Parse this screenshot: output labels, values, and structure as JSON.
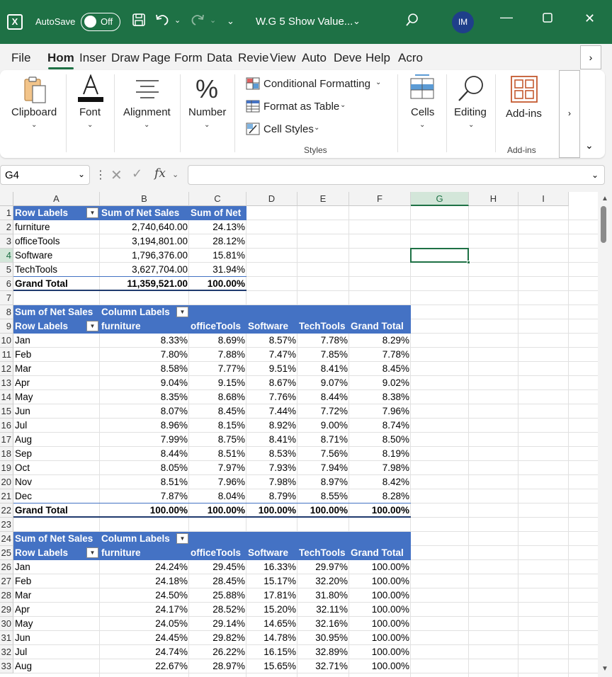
{
  "titlebar": {
    "autosave_label": "AutoSave",
    "autosave_state": "Off",
    "doc_title": "W.G 5 Show Value...",
    "avatar_initials": "IM",
    "accent_color": "#1e7145"
  },
  "tabs": [
    "File",
    "Hom",
    "Inser",
    "Draw",
    "Page",
    "Form",
    "Data",
    "Revie",
    "View",
    "Auto",
    "Deve",
    "Help",
    "Acro"
  ],
  "ribbon": {
    "clipboard": "Clipboard",
    "font": "Font",
    "alignment": "Alignment",
    "number": "Number",
    "conditional_formatting": "Conditional Formatting",
    "format_as_table": "Format as Table",
    "cell_styles": "Cell Styles",
    "styles_group": "Styles",
    "cells": "Cells",
    "editing": "Editing",
    "addins": "Add-ins",
    "addins_group": "Add-ins"
  },
  "formula_bar": {
    "name_box": "G4",
    "fx": "fx",
    "formula": ""
  },
  "columns": [
    "A",
    "B",
    "C",
    "D",
    "E",
    "F",
    "G",
    "H",
    "I"
  ],
  "selected_column": "G",
  "selected_row": 4,
  "rows": [
    "1",
    "2",
    "3",
    "4",
    "5",
    "6",
    "7",
    "8",
    "9",
    "10",
    "11",
    "12",
    "13",
    "14",
    "15",
    "16",
    "17",
    "18",
    "19",
    "20",
    "21",
    "22",
    "23",
    "24",
    "25",
    "26",
    "27",
    "28",
    "29",
    "30",
    "31",
    "32",
    "33"
  ],
  "pivot1": {
    "headers": [
      "Row Labels",
      "Sum of Net Sales",
      "Sum of Net"
    ],
    "rows": [
      [
        "furniture",
        "2,740,640.00",
        "24.13%"
      ],
      [
        "officeTools",
        "3,194,801.00",
        "28.12%"
      ],
      [
        "Software",
        "1,796,376.00",
        "15.81%"
      ],
      [
        "TechTools",
        "3,627,704.00",
        "31.94%"
      ]
    ],
    "total": [
      "Grand Total",
      "11,359,521.00",
      "100.00%"
    ]
  },
  "pivot2": {
    "title": "Sum of Net Sales",
    "column_labels": "Column Labels",
    "headers": [
      "Row Labels",
      "furniture",
      "officeTools",
      "Software",
      "TechTools",
      "Grand Total"
    ],
    "rows": [
      [
        "Jan",
        "8.33%",
        "8.69%",
        "8.57%",
        "7.78%",
        "8.29%"
      ],
      [
        "Feb",
        "7.80%",
        "7.88%",
        "7.47%",
        "7.85%",
        "7.78%"
      ],
      [
        "Mar",
        "8.58%",
        "7.77%",
        "9.51%",
        "8.41%",
        "8.45%"
      ],
      [
        "Apr",
        "9.04%",
        "9.15%",
        "8.67%",
        "9.07%",
        "9.02%"
      ],
      [
        "May",
        "8.35%",
        "8.68%",
        "7.76%",
        "8.44%",
        "8.38%"
      ],
      [
        "Jun",
        "8.07%",
        "8.45%",
        "7.44%",
        "7.72%",
        "7.96%"
      ],
      [
        "Jul",
        "8.96%",
        "8.15%",
        "8.92%",
        "9.00%",
        "8.74%"
      ],
      [
        "Aug",
        "7.99%",
        "8.75%",
        "8.41%",
        "8.71%",
        "8.50%"
      ],
      [
        "Sep",
        "8.44%",
        "8.51%",
        "8.53%",
        "7.56%",
        "8.19%"
      ],
      [
        "Oct",
        "8.05%",
        "7.97%",
        "7.93%",
        "7.94%",
        "7.98%"
      ],
      [
        "Nov",
        "8.51%",
        "7.96%",
        "7.98%",
        "8.97%",
        "8.42%"
      ],
      [
        "Dec",
        "7.87%",
        "8.04%",
        "8.79%",
        "8.55%",
        "8.28%"
      ]
    ],
    "total": [
      "Grand Total",
      "100.00%",
      "100.00%",
      "100.00%",
      "100.00%",
      "100.00%"
    ]
  },
  "pivot3": {
    "title": "Sum of Net Sales",
    "column_labels": "Column Labels",
    "headers": [
      "Row Labels",
      "furniture",
      "officeTools",
      "Software",
      "TechTools",
      "Grand Total"
    ],
    "rows": [
      [
        "Jan",
        "24.24%",
        "29.45%",
        "16.33%",
        "29.97%",
        "100.00%"
      ],
      [
        "Feb",
        "24.18%",
        "28.45%",
        "15.17%",
        "32.20%",
        "100.00%"
      ],
      [
        "Mar",
        "24.50%",
        "25.88%",
        "17.81%",
        "31.80%",
        "100.00%"
      ],
      [
        "Apr",
        "24.17%",
        "28.52%",
        "15.20%",
        "32.11%",
        "100.00%"
      ],
      [
        "May",
        "24.05%",
        "29.14%",
        "14.65%",
        "32.16%",
        "100.00%"
      ],
      [
        "Jun",
        "24.45%",
        "29.82%",
        "14.78%",
        "30.95%",
        "100.00%"
      ],
      [
        "Jul",
        "24.74%",
        "26.22%",
        "16.15%",
        "32.89%",
        "100.00%"
      ],
      [
        "Aug",
        "22.67%",
        "28.97%",
        "15.65%",
        "32.71%",
        "100.00%"
      ]
    ]
  }
}
